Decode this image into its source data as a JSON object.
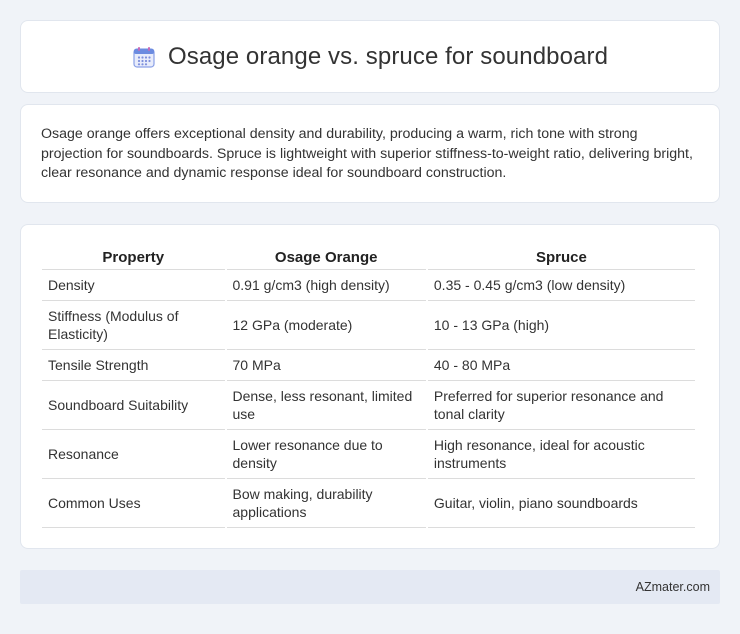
{
  "header": {
    "title": "Osage orange vs. spruce for soundboard",
    "icon": "calendar-icon"
  },
  "summary": {
    "text": "Osage orange offers exceptional density and durability, producing a warm, rich tone with strong projection for soundboards. Spruce is lightweight with superior stiffness-to-weight ratio, delivering bright, clear resonance and dynamic response ideal for soundboard construction."
  },
  "table": {
    "headers": [
      "Property",
      "Osage Orange",
      "Spruce"
    ],
    "rows": [
      [
        "Density",
        "0.91 g/cm3 (high density)",
        "0.35 - 0.45 g/cm3 (low density)"
      ],
      [
        "Stiffness (Modulus of Elasticity)",
        "12 GPa (moderate)",
        "10 - 13 GPa (high)"
      ],
      [
        "Tensile Strength",
        "70 MPa",
        "40 - 80 MPa"
      ],
      [
        "Soundboard Suitability",
        "Dense, less resonant, limited use",
        "Preferred for superior resonance and tonal clarity"
      ],
      [
        "Resonance",
        "Lower resonance due to density",
        "High resonance, ideal for acoustic instruments"
      ],
      [
        "Common Uses",
        "Bow making, durability applications",
        "Guitar, violin, piano soundboards"
      ]
    ]
  },
  "footer": {
    "brand": "AZmater.com"
  },
  "colors": {
    "background": "#f0f3f8",
    "card": "#ffffff",
    "footer": "#e4e9f3",
    "icon_accent": "#5b7fd6"
  }
}
